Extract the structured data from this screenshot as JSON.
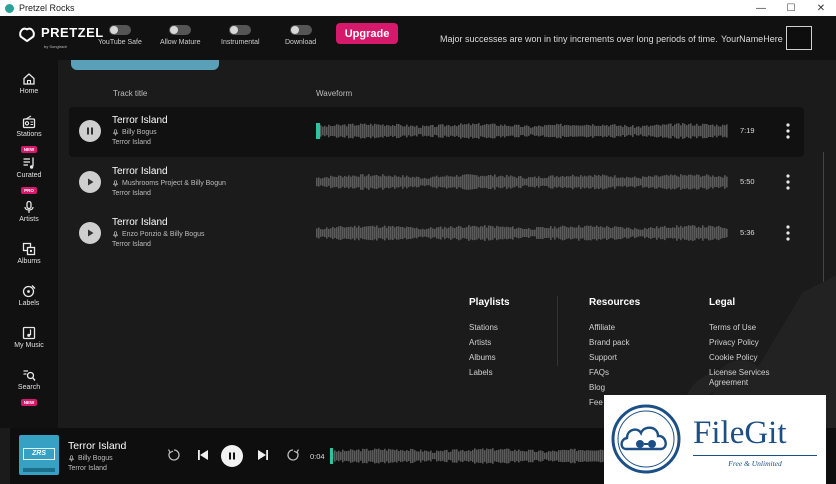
{
  "window": {
    "title": "Pretzel Rocks",
    "controls": {
      "minimize": "—",
      "maximize": "☐",
      "close": "✕"
    }
  },
  "header": {
    "logo_text": "PRETZEL",
    "logo_sub": "by Songtradr",
    "toggles": [
      {
        "label": "YouTube Safe",
        "on": false
      },
      {
        "label": "Allow Mature",
        "on": false
      },
      {
        "label": "Instrumental",
        "on": false
      },
      {
        "label": "Download",
        "on": false
      }
    ],
    "upgrade_label": "Upgrade",
    "quote": "Major successes are won in tiny increments over long periods of time.",
    "username": "YourNameHere",
    "accent": "#d6196a"
  },
  "sidebar": {
    "items": [
      {
        "label": "Home",
        "icon": "home-icon",
        "badge": ""
      },
      {
        "label": "Stations",
        "icon": "radio-icon",
        "badge": "NEW"
      },
      {
        "label": "Curated",
        "icon": "list-icon",
        "badge": "PRO"
      },
      {
        "label": "Artists",
        "icon": "mic-icon",
        "badge": ""
      },
      {
        "label": "Albums",
        "icon": "albums-icon",
        "badge": ""
      },
      {
        "label": "Labels",
        "icon": "label-icon",
        "badge": ""
      },
      {
        "label": "My Music",
        "icon": "music-note-icon",
        "badge": ""
      },
      {
        "label": "Search",
        "icon": "search-icon",
        "badge": "NEW"
      }
    ]
  },
  "tracklist": {
    "headers": {
      "title": "Track title",
      "waveform": "Waveform"
    },
    "tracks": [
      {
        "title": "Terror Island",
        "artist": "Billy Bogus",
        "album": "Terror Island",
        "duration": "7:19",
        "playing": true,
        "progress": 0.01
      },
      {
        "title": "Terror Island",
        "artist": "Mushrooms Project & Billy Bogun",
        "album": "Terror Island",
        "duration": "5:50",
        "playing": false,
        "progress": 0
      },
      {
        "title": "Terror Island",
        "artist": "Enzo Ponzio & Billy Bogus",
        "album": "Terror Island",
        "duration": "5:36",
        "playing": false,
        "progress": 0
      }
    ]
  },
  "footer": {
    "columns": [
      {
        "title": "Playlists",
        "links": [
          "Stations",
          "Artists",
          "Albums",
          "Labels"
        ]
      },
      {
        "title": "Resources",
        "links": [
          "Affiliate",
          "Brand pack",
          "Support",
          "FAQs",
          "Blog",
          "Fee"
        ]
      },
      {
        "title": "Legal",
        "links": [
          "Terms of Use",
          "Privacy Policy",
          "Cookie Policy",
          "License Services",
          "Agreement"
        ]
      }
    ]
  },
  "player": {
    "cover_text": "ZRS",
    "title": "Terror Island",
    "artist": "Billy Bogus",
    "album": "Terror Island",
    "elapsed": "0:04",
    "progress": 0.01
  },
  "badge": {
    "name": "FileGit",
    "tagline": "Free & Unlimited"
  }
}
